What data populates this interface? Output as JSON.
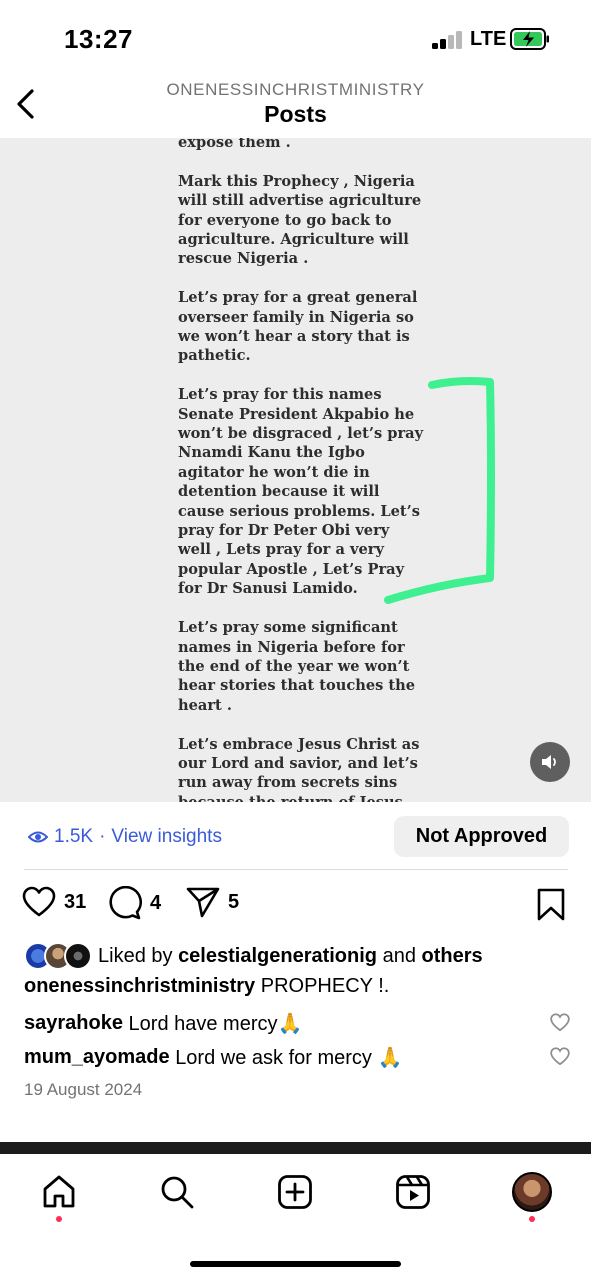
{
  "status_bar": {
    "time": "13:27",
    "network": "LTE"
  },
  "header": {
    "account": "ONENESSINCHRISTMINISTRY",
    "title": "Posts"
  },
  "post": {
    "article_paragraphs": [
      "expose them .",
      "Mark this Prophecy , Nigeria\nwill still advertise agriculture\nfor everyone to go back to\nagriculture. Agriculture will\nrescue Nigeria .",
      "Let’s pray for a great general\noverseer family in Nigeria so\nwe won’t hear a story that is\npathetic.",
      "Let’s pray for this names\nSenate President Akpabio he\nwon’t be disgraced ,  let’s pray\nNnamdi Kanu the Igbo\nagitator he won’t die in\ndetention because it will\ncause serious problems.  Let’s\npray for Dr Peter Obi very\nwell ,  Lets pray for a very\npopular Apostle , Let’s Pray\nfor Dr Sanusi Lamido.",
      "Let’s pray some significant\nnames in Nigeria before  for\nthe end of the year we won’t\nhear stories that touches the\nheart .",
      "Let’s embrace Jesus Christ as\nour Lord and savior, and let’s\nrun away from secrets sins\nbecause the return of Jesus"
    ],
    "highlight_color": "#3ef08f",
    "views": "1.5K",
    "view_insights": "View insights",
    "view_separator": "·",
    "approval_status": "Not Approved",
    "likes_count": "31",
    "comments_count": "4",
    "shares_count": "5",
    "liked_by_prefix": "Liked by",
    "liked_by_user": "celestialgenerationig",
    "liked_by_and": "and",
    "liked_by_others": "others",
    "caption_user": "onenessinchristministry",
    "caption_text": "PROPHECY !.",
    "comments": [
      {
        "user": "sayrahoke",
        "text": "Lord have mercy🙏"
      },
      {
        "user": "mum_ayomade",
        "text": "Lord we ask for mercy 🙏"
      }
    ],
    "date": "19 August 2024"
  },
  "colors": {
    "link": "#3a5bd9",
    "notification_dot": "#ff2d55",
    "muted_text": "#737373"
  },
  "nav": [
    "home-icon",
    "search-icon",
    "create-icon",
    "reels-icon",
    "profile-avatar"
  ]
}
